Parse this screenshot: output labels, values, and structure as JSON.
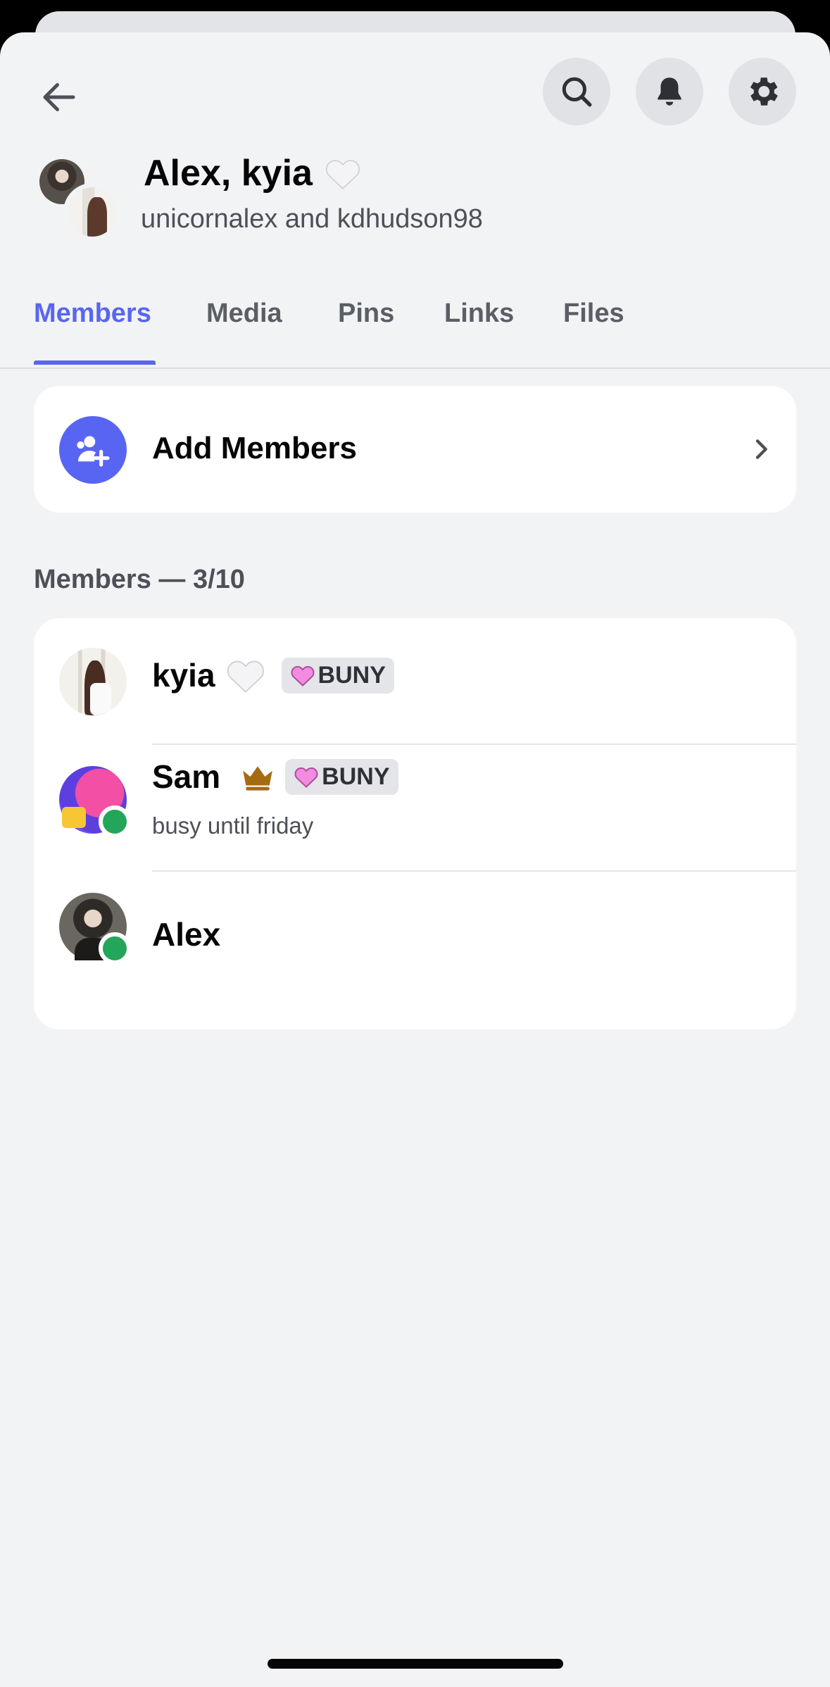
{
  "header": {
    "title": "Alex, kyia",
    "subtitle": "unicornalex and kdhudson98"
  },
  "tabs": [
    {
      "label": "Members",
      "active": true
    },
    {
      "label": "Media",
      "active": false
    },
    {
      "label": "Pins",
      "active": false
    },
    {
      "label": "Links",
      "active": false
    },
    {
      "label": "Files",
      "active": false
    }
  ],
  "add_members": {
    "label": "Add Members"
  },
  "members_section": {
    "label": "Members — 3/10"
  },
  "members": [
    {
      "name": "kyia",
      "badge": "BUNY",
      "status": "",
      "online": false
    },
    {
      "name": "Sam",
      "badge": "BUNY",
      "status": "busy until friday",
      "online": true
    },
    {
      "name": "Alex",
      "badge": "",
      "status": "",
      "online": true
    }
  ],
  "colors": {
    "accent": "#5865f2",
    "online": "#23a55a",
    "background": "#f2f3f5"
  },
  "icons": {
    "back": "arrow-left-icon",
    "search": "search-icon",
    "notifications": "bell-icon",
    "settings": "gear-icon"
  }
}
